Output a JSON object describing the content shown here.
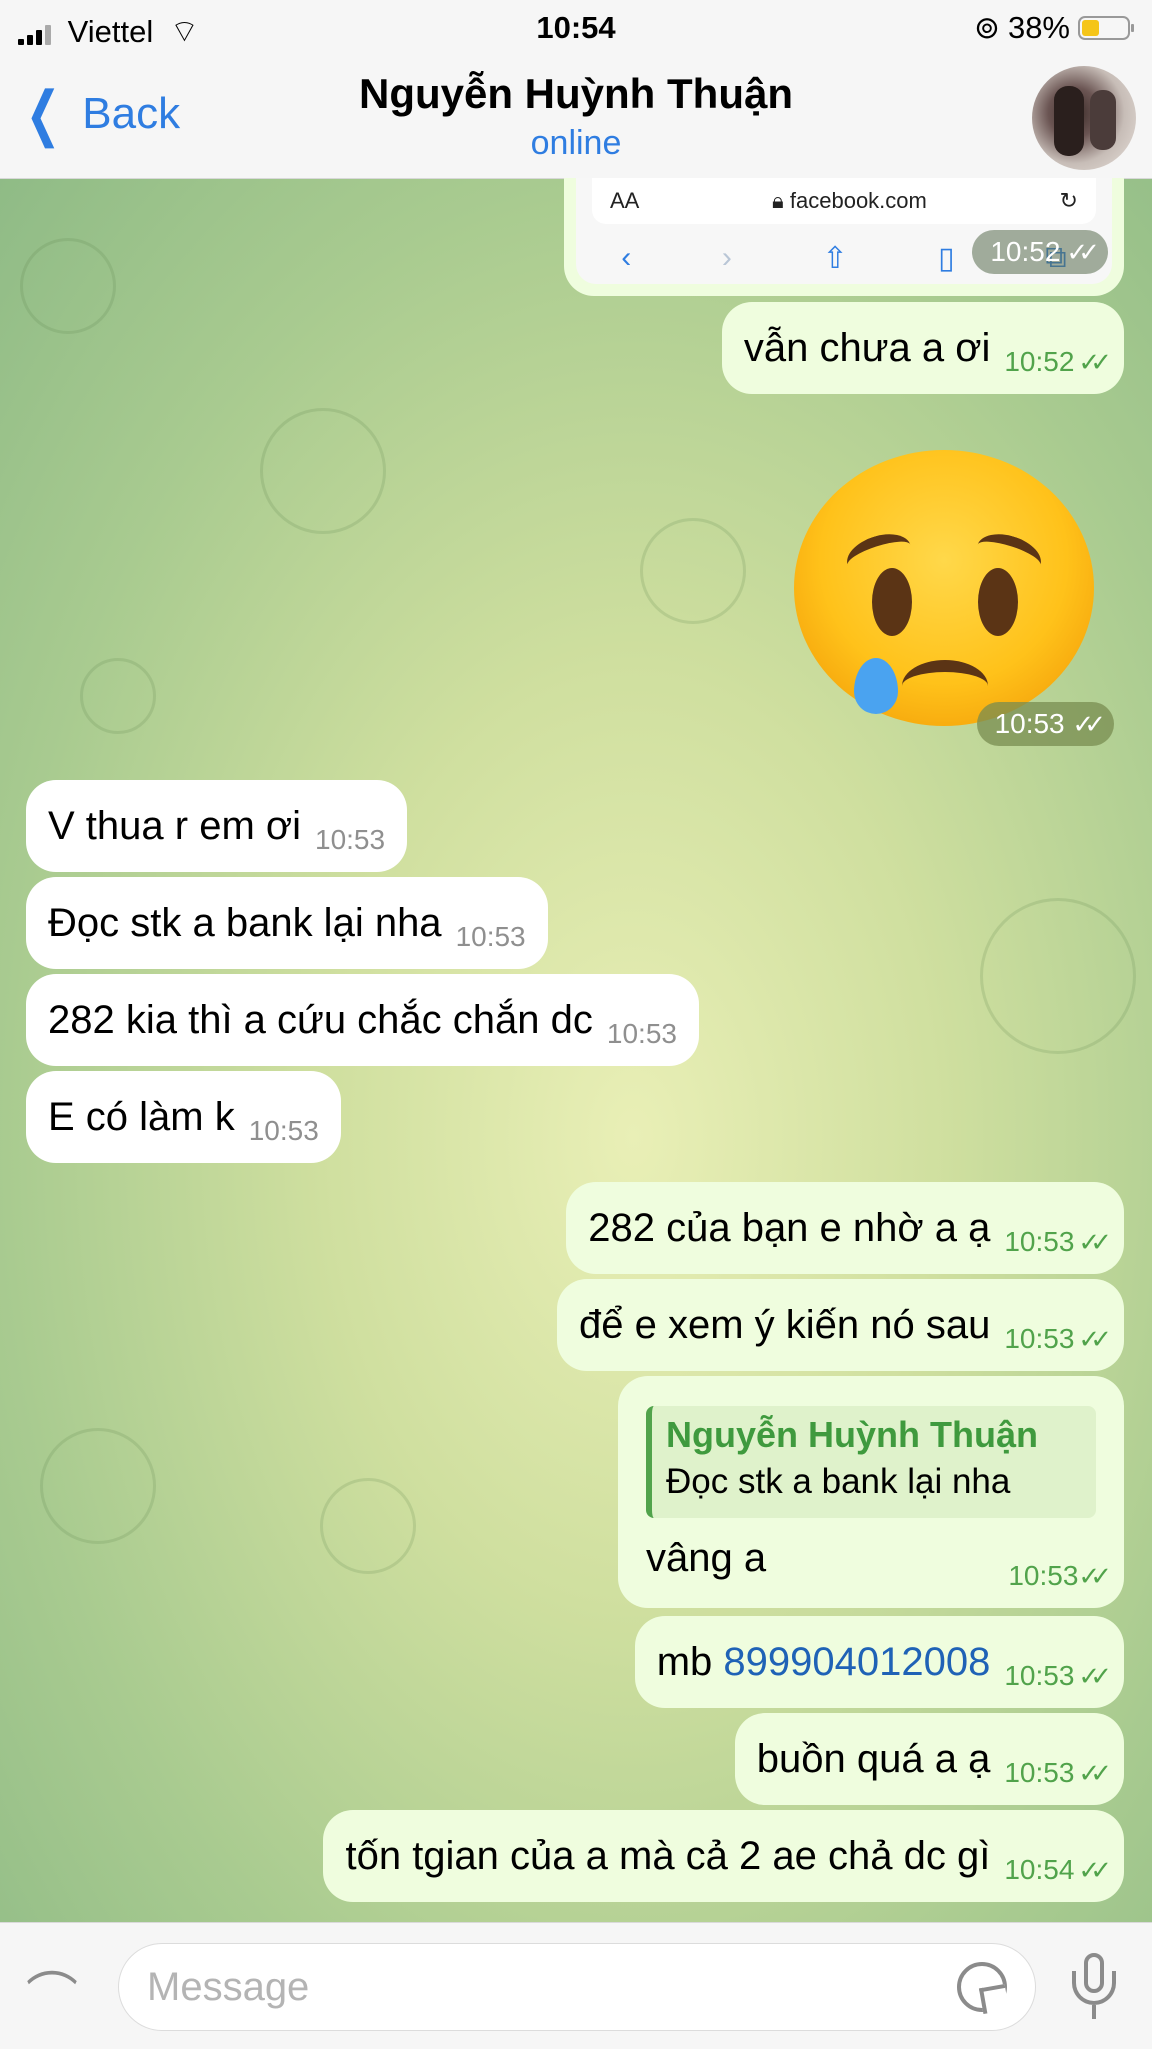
{
  "status_bar": {
    "carrier": "Viettel",
    "time": "10:54",
    "battery_text": "38%",
    "battery_level": 0.38,
    "battery_color": "#f5c518"
  },
  "header": {
    "back_label": "Back",
    "title": "Nguyễn Huỳnh Thuận",
    "subtitle": "online",
    "accent_color": "#2f7de1"
  },
  "top_media": {
    "aa_label": "AA",
    "url": "facebook.com",
    "time": "10:52",
    "icons": [
      "chevron-left-icon",
      "chevron-right-icon",
      "share-icon",
      "bookmarks-icon",
      "tabs-icon",
      "reload-icon",
      "lock-icon"
    ]
  },
  "messages": [
    {
      "dir": "out",
      "text": "vẫn chưa a ơi",
      "time": "10:52"
    },
    {
      "dir": "out",
      "type": "sticker",
      "emoji": "sad-face-with-tear",
      "time": "10:53"
    },
    {
      "dir": "in",
      "text": "V thua r em ơi",
      "time": "10:53"
    },
    {
      "dir": "in",
      "text": "Đọc stk a bank lại nha",
      "time": "10:53"
    },
    {
      "dir": "in",
      "text": "282 kia thì a cứu chắc chắn dc",
      "time": "10:53"
    },
    {
      "dir": "in",
      "text": "E có làm k",
      "time": "10:53"
    },
    {
      "dir": "out",
      "text": "282 của bạn e nhờ a ạ",
      "time": "10:53"
    },
    {
      "dir": "out",
      "text": "để e xem ý kiến nó sau",
      "time": "10:53"
    },
    {
      "dir": "out",
      "type": "reply",
      "reply_name": "Nguyễn Huỳnh Thuận",
      "reply_text": "Đọc stk a bank lại nha",
      "text": "vâng a",
      "time": "10:53"
    },
    {
      "dir": "out",
      "text_prefix": "mb ",
      "link": "899904012008",
      "time": "10:53"
    },
    {
      "dir": "out",
      "text": "buồn quá a ạ",
      "time": "10:53"
    },
    {
      "dir": "out",
      "text": "tốn tgian của a mà cả 2 ae chả dc gì",
      "time": "10:54"
    }
  ],
  "input": {
    "placeholder": "Message"
  },
  "colors": {
    "outgoing_bubble": "#effdde",
    "incoming_bubble": "#ffffff",
    "read_check": "#51a34b",
    "link": "#1f62b6"
  }
}
